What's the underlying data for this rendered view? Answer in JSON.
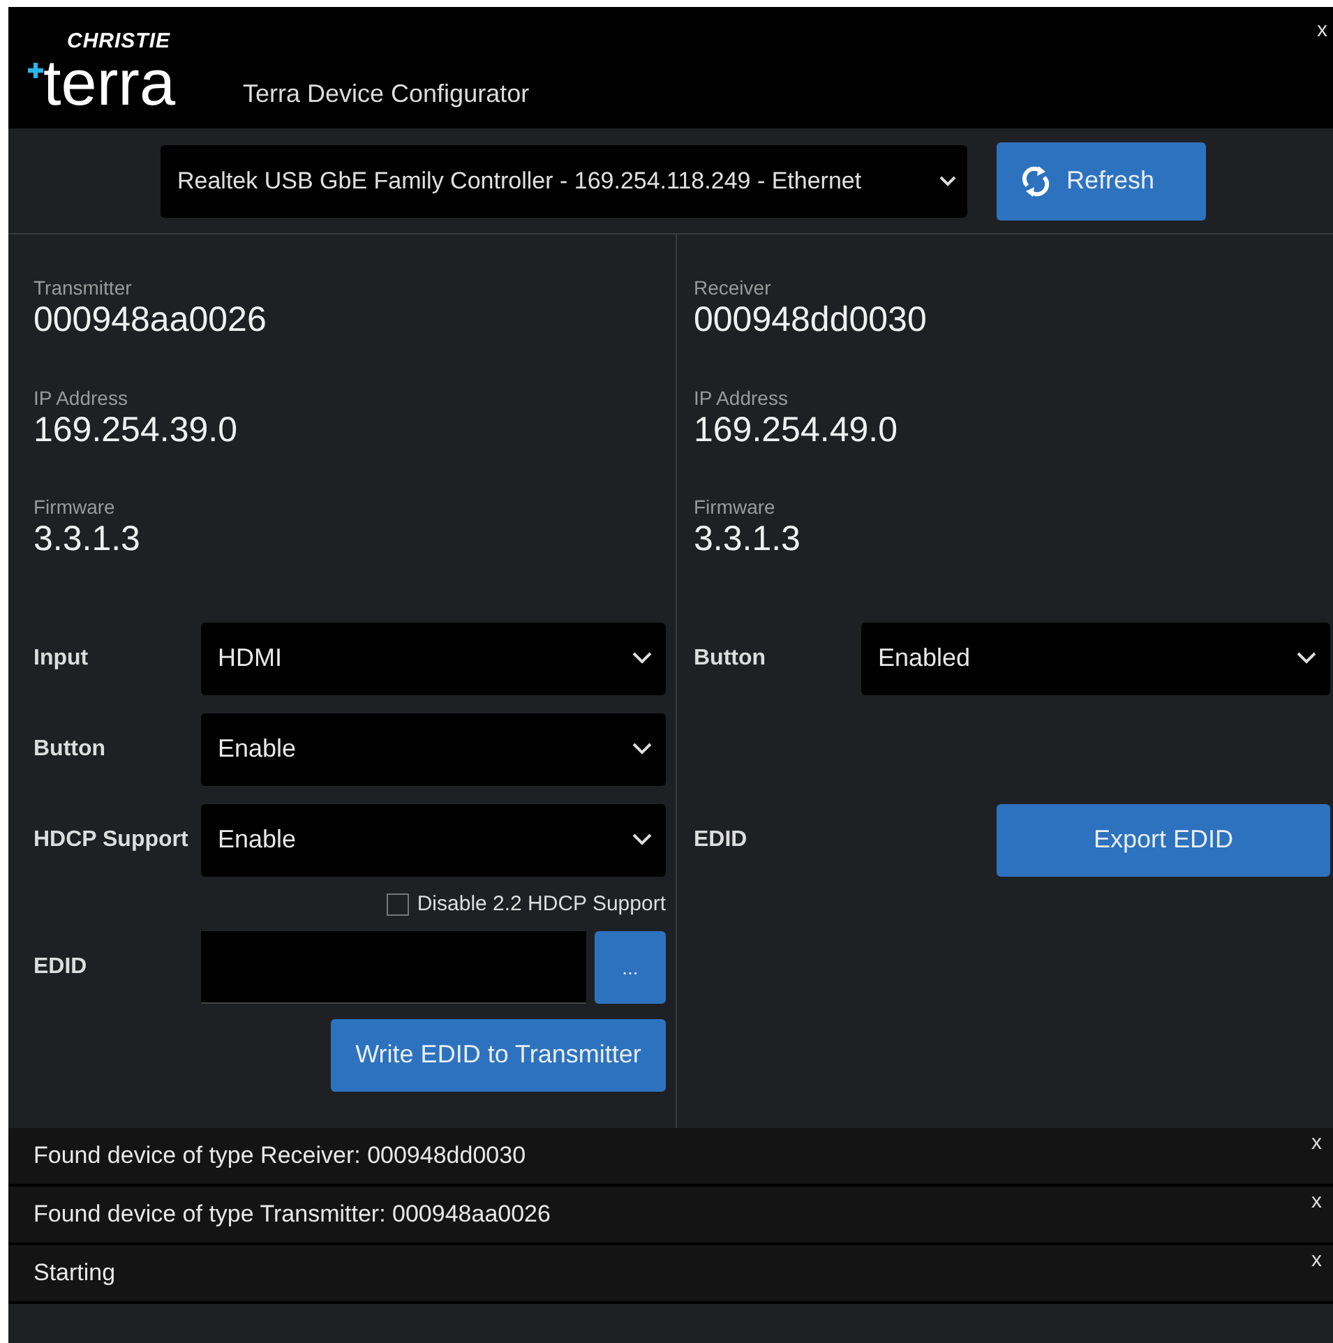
{
  "window": {
    "brand": "CHRISTIE",
    "logo": "terra",
    "title": "Terra Device Configurator",
    "close": "x"
  },
  "adapter": {
    "value": "Realtek USB GbE Family Controller - 169.254.118.249 - Ethernet",
    "refresh": "Refresh"
  },
  "transmitter": {
    "fields": [
      {
        "label": "Transmitter",
        "value": "000948aa0026"
      },
      {
        "label": "IP Address",
        "value": "169.254.39.0"
      },
      {
        "label": "Firmware",
        "value": "3.3.1.3"
      }
    ],
    "settings": [
      {
        "kind": "select",
        "label": "Input",
        "value": "HDMI"
      },
      {
        "kind": "select",
        "label": "Button",
        "value": "Enable"
      },
      {
        "kind": "select",
        "label": "HDCP Support",
        "value": "Enable"
      },
      {
        "kind": "checkbox",
        "label": "Disable 2.2 HDCP Support",
        "checked": false
      },
      {
        "kind": "file",
        "label": "EDID",
        "browse": "..."
      },
      {
        "kind": "action",
        "label": "Write EDID to Transmitter"
      }
    ]
  },
  "receiver": {
    "fields": [
      {
        "label": "Receiver",
        "value": "000948dd0030"
      },
      {
        "label": "IP Address",
        "value": "169.254.49.0"
      },
      {
        "label": "Firmware",
        "value": "3.3.1.3"
      }
    ],
    "settings": [
      {
        "kind": "select",
        "label": "Button",
        "value": "Enabled"
      },
      {
        "kind": "export",
        "label": "EDID",
        "button": "Export EDID"
      }
    ]
  },
  "log": [
    {
      "text": "Found device of type Receiver: 000948dd0030",
      "close": "x"
    },
    {
      "text": "Found device of type Transmitter: 000948aa0026",
      "close": "x"
    },
    {
      "text": "Starting",
      "close": "x"
    }
  ]
}
